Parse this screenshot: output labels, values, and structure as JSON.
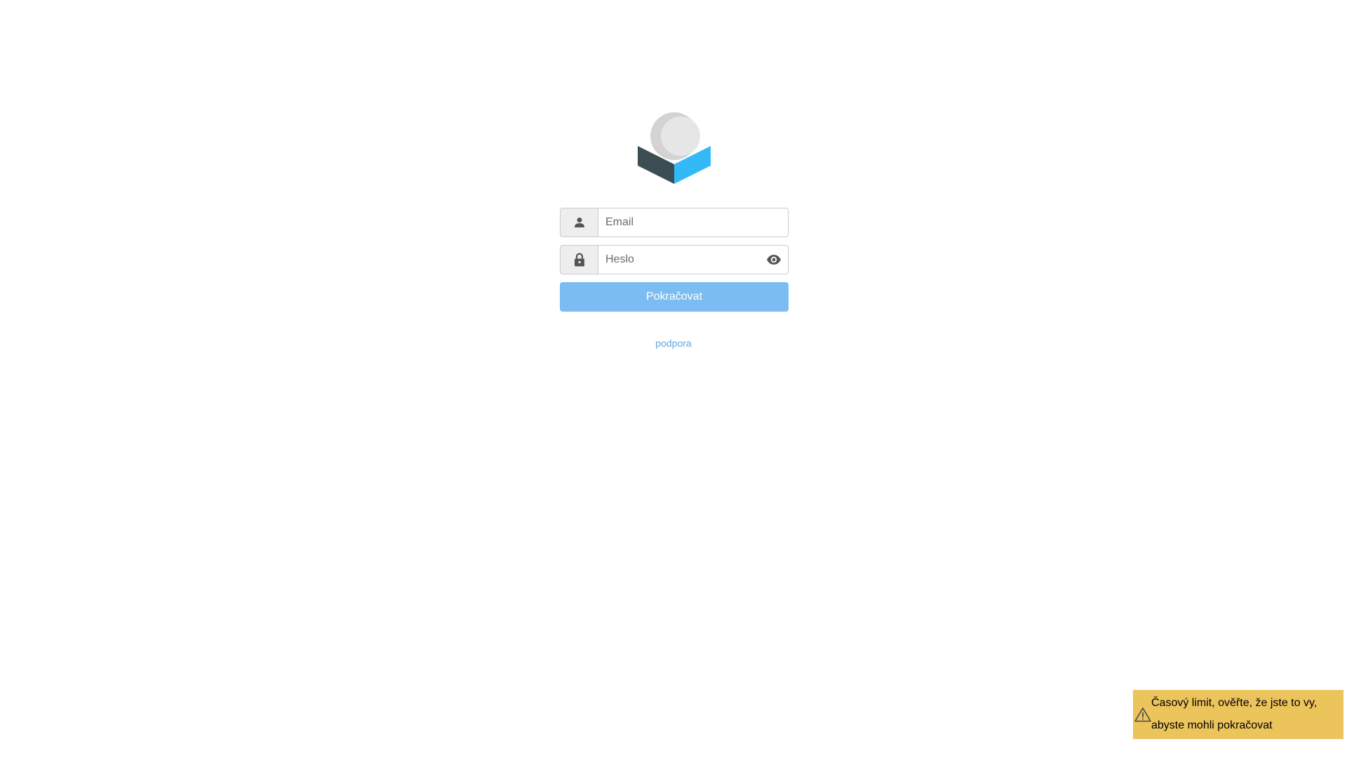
{
  "logo": {
    "name": "app-logo"
  },
  "login": {
    "email_placeholder": "Email",
    "email_value": "",
    "password_placeholder": "Heslo",
    "password_value": "",
    "submit_label": "Pokračovat"
  },
  "support": {
    "link_label": "podpora"
  },
  "toast": {
    "message": "Časový limit, ověřte, že jste to vy, abyste mohli pokračovat",
    "icon": "warning-icon"
  },
  "icons": {
    "email": "user-icon",
    "password": "lock-icon",
    "reveal": "eye-icon"
  },
  "colors": {
    "button_bg": "#7bbcf3",
    "link": "#5fa8e0",
    "toast_bg": "#ecc45c",
    "logo_dark": "#3c4d53",
    "logo_blue": "#33b9f7",
    "logo_light": "#e2e2e2"
  }
}
